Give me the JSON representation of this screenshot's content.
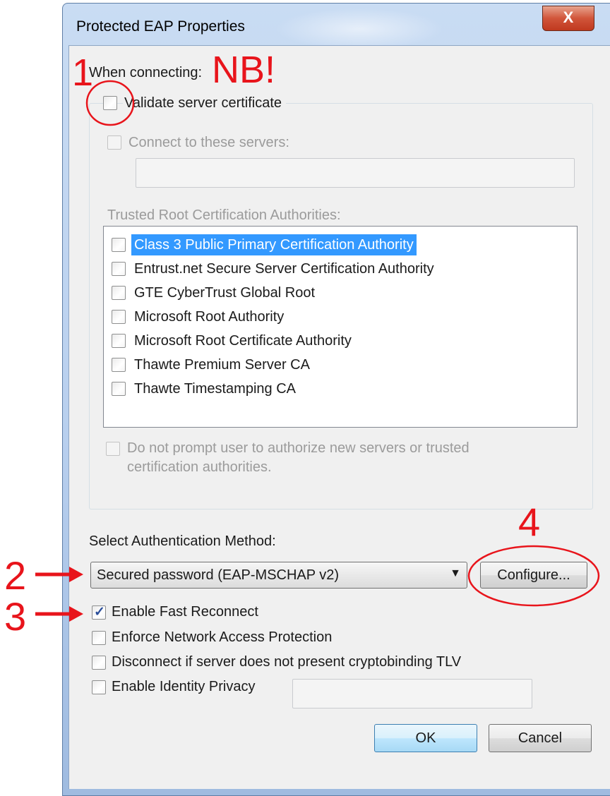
{
  "window": {
    "title": "Protected EAP Properties",
    "close_glyph": "X"
  },
  "when_connecting_label": "When connecting:",
  "validate_cert": {
    "label": "Validate server certificate",
    "checked": false
  },
  "connect_servers": {
    "label": "Connect to these servers:",
    "checked": false,
    "value": ""
  },
  "trusted_root_label": "Trusted Root Certification Authorities:",
  "trusted_roots": [
    {
      "label": "Class 3 Public Primary Certification Authority",
      "checked": false,
      "selected": true
    },
    {
      "label": "Entrust.net Secure Server Certification Authority",
      "checked": false
    },
    {
      "label": "GTE CyberTrust Global Root",
      "checked": false
    },
    {
      "label": "Microsoft Root Authority",
      "checked": false
    },
    {
      "label": "Microsoft Root Certificate Authority",
      "checked": false
    },
    {
      "label": "Thawte Premium Server CA",
      "checked": false
    },
    {
      "label": "Thawte Timestamping CA",
      "checked": false
    }
  ],
  "do_not_prompt": {
    "line1": "Do not prompt user to authorize new servers or trusted",
    "line2": "certification authorities.",
    "checked": false
  },
  "auth_method_label": "Select Authentication Method:",
  "auth_method": {
    "selected": "Secured password (EAP-MSCHAP v2)"
  },
  "configure_label": "Configure...",
  "options": [
    {
      "label": "Enable Fast Reconnect",
      "checked": true
    },
    {
      "label": "Enforce Network Access Protection",
      "checked": false
    },
    {
      "label": "Disconnect if server does not present cryptobinding TLV",
      "checked": false
    },
    {
      "label": "Enable Identity Privacy",
      "checked": false
    }
  ],
  "identity_privacy_value": "",
  "ok_label": "OK",
  "cancel_label": "Cancel",
  "annotations": {
    "n1": "1",
    "nb": "NB!",
    "n2": "2",
    "n3": "3",
    "n4": "4",
    "color": "#e8141b"
  },
  "colors": {
    "selection": "#3399ff",
    "close_button": "#c0391f"
  }
}
